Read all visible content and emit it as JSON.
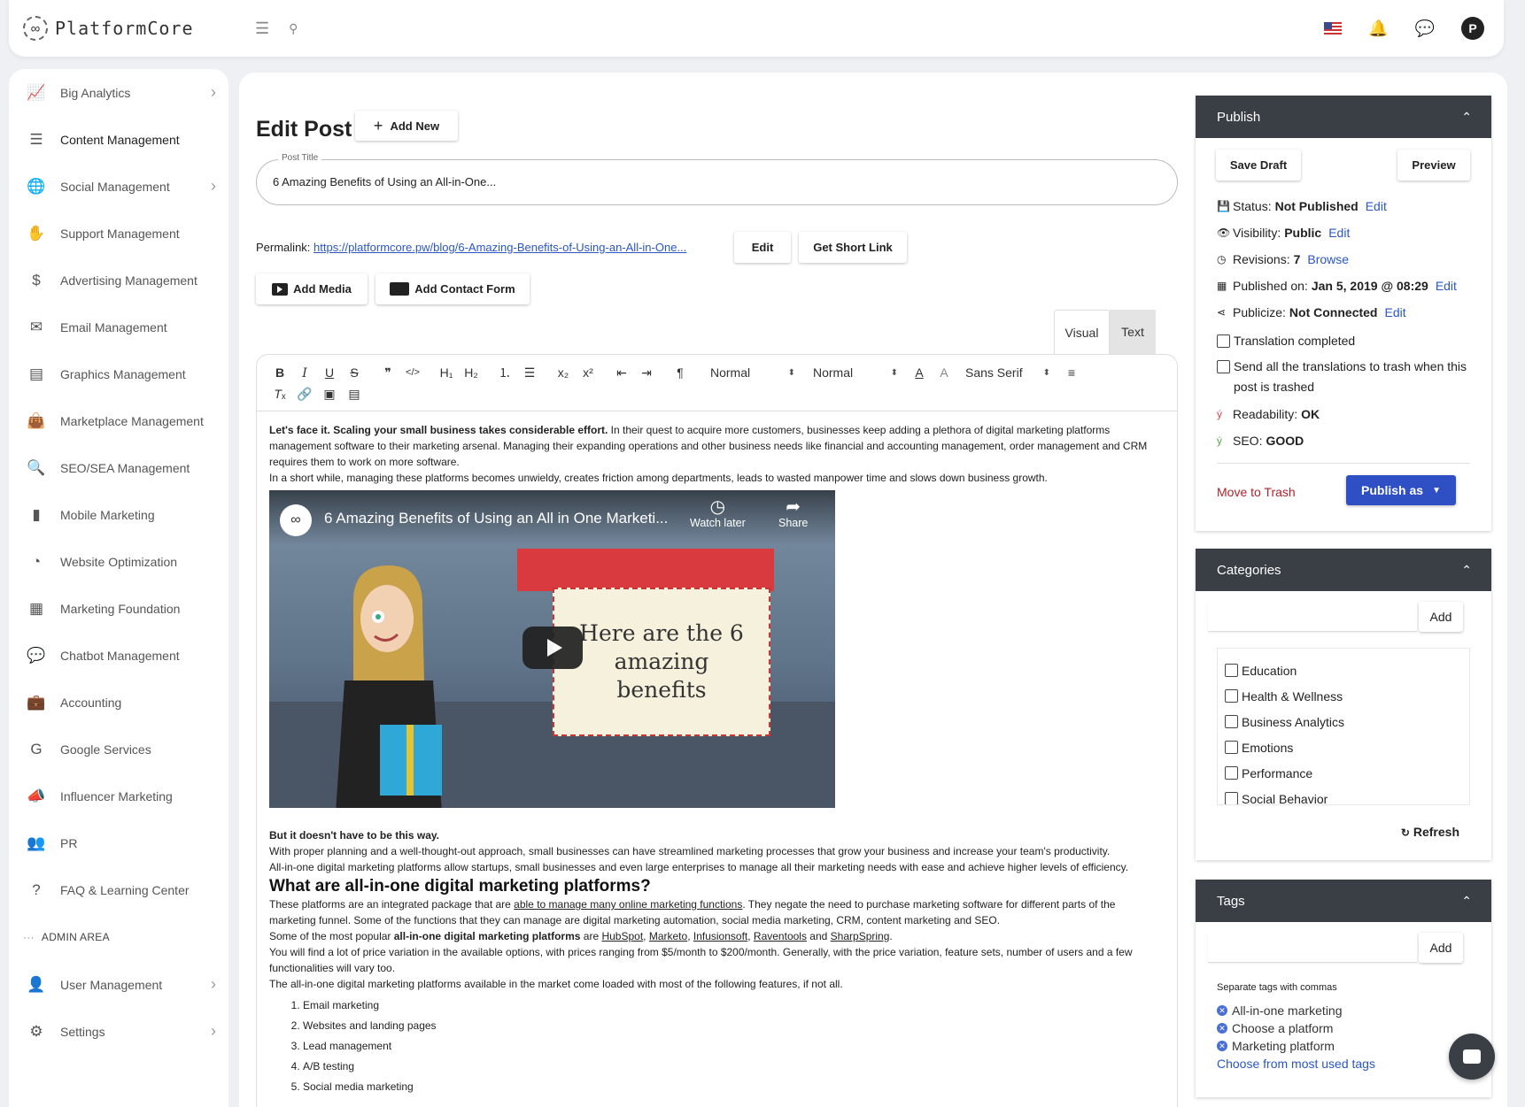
{
  "brand": {
    "name": "PlatformCore"
  },
  "topbar": {
    "menu_icon": "hamburger-icon",
    "search_icon": "search-icon",
    "flag_icon": "us-flag-icon",
    "bell_icon": "bell-icon",
    "chat_icon": "chat-icon",
    "avatar_letter": "P"
  },
  "sidebar": {
    "items": [
      {
        "label": "Big Analytics",
        "icon": "chart-line-icon",
        "glyph": "📈",
        "chevron": true
      },
      {
        "label": "Content Management",
        "icon": "list-icon",
        "glyph": "☰",
        "chevron": false
      },
      {
        "label": "Social Management",
        "icon": "globe-icon",
        "glyph": "🌐",
        "chevron": true
      },
      {
        "label": "Support Management",
        "icon": "hand-icon",
        "glyph": "✋",
        "chevron": false
      },
      {
        "label": "Advertising Management",
        "icon": "dollar-hand-icon",
        "glyph": "$",
        "chevron": false
      },
      {
        "label": "Email Management",
        "icon": "envelope-icon",
        "glyph": "✉",
        "chevron": false
      },
      {
        "label": "Graphics Management",
        "icon": "image-file-icon",
        "glyph": "▤",
        "chevron": false
      },
      {
        "label": "Marketplace Management",
        "icon": "bag-icon",
        "glyph": "👜",
        "chevron": false
      },
      {
        "label": "SEO/SEA Management",
        "icon": "search-dollar-icon",
        "glyph": "🔍",
        "chevron": false
      },
      {
        "label": "Mobile Marketing",
        "icon": "mobile-icon",
        "glyph": "▮",
        "chevron": false
      },
      {
        "label": "Website Optimization",
        "icon": "gauge-icon",
        "glyph": "◔",
        "chevron": false
      },
      {
        "label": "Marketing Foundation",
        "icon": "boxes-icon",
        "glyph": "▦",
        "chevron": false
      },
      {
        "label": "Chatbot Management",
        "icon": "chat-bubble-icon",
        "glyph": "💬",
        "chevron": false
      },
      {
        "label": "Accounting",
        "icon": "briefcase-icon",
        "glyph": "💼",
        "chevron": false
      },
      {
        "label": "Google Services",
        "icon": "google-icon",
        "glyph": "G",
        "chevron": false
      },
      {
        "label": "Influencer Marketing",
        "icon": "megaphone-icon",
        "glyph": "📣",
        "chevron": false
      },
      {
        "label": "PR",
        "icon": "users-icon",
        "glyph": "👥",
        "chevron": false
      },
      {
        "label": "FAQ & Learning Center",
        "icon": "question-icon",
        "glyph": "?",
        "chevron": false
      }
    ],
    "admin_section": "ADMIN AREA",
    "admin_items": [
      {
        "label": "User Management",
        "icon": "user-circle-icon",
        "glyph": "👤",
        "chevron": true
      },
      {
        "label": "Settings",
        "icon": "gear-icon",
        "glyph": "⚙",
        "chevron": true
      }
    ]
  },
  "editor": {
    "page_title": "Edit Post",
    "add_new_label": "Add New",
    "post_title_label": "Post Title",
    "post_title_value": "6 Amazing Benefits of Using an All-in-One...",
    "permalink_label": "Permalink:",
    "permalink_url": "https://platformcore.pw/blog/6-Amazing-Benefits-of-Using-an-All-in-One...",
    "edit_label": "Edit",
    "short_link_label": "Get Short Link",
    "add_media_label": "Add Media",
    "add_form_label": "Add Contact Form",
    "tab_visual": "Visual",
    "tab_text": "Text",
    "toolbar": {
      "heading_select": "Normal",
      "size_select": "Normal",
      "font_select": "Sans Serif"
    }
  },
  "content": {
    "p1_bold": "Let's face it. Scaling your small business takes considerable effort.",
    "p1_rest": " In their quest to acquire more customers, businesses keep adding a plethora of digital marketing platforms management software to their marketing arsenal. Managing their expanding operations and other business needs like financial and accounting management, order management and CRM requires them to work on more software.",
    "p2": "In a short while, managing these platforms becomes unwieldy, creates friction among departments, leads to wasted manpower time and slows down business growth.",
    "video_title": "6 Amazing Benefits of Using an All in One Marketi...",
    "video_watch_later": "Watch later",
    "video_share": "Share",
    "video_sign_l1": "Here are the 6",
    "video_sign_l2": "amazing",
    "video_sign_l3": "benefits",
    "p3_bold": "But it doesn't have to be this way.",
    "p4": "With proper planning and a well-thought-out approach, small businesses can have streamlined marketing processes that grow your business and increase your team's productivity.",
    "p5": "All-in-one digital marketing platforms allow startups, small businesses and even large enterprises to manage all their marketing needs with ease and achieve higher levels of efficiency.",
    "h2": "What are all-in-one digital marketing platforms?",
    "p6_a": "These platforms are an integrated package that are ",
    "p6_link": "able to manage many online marketing functions",
    "p6_b": ". They negate the need to purchase marketing software for different parts of the marketing funnel. Some of the functions that they can manage are digital marketing automation, social media marketing, CRM, content marketing and SEO.",
    "p7_a": "Some of the most popular ",
    "p7_bold": "all-in-one digital marketing platforms",
    "p7_b": " are ",
    "p7_l1": "HubSpot",
    "p7_c1": ", ",
    "p7_l2": "Marketo",
    "p7_c2": ", ",
    "p7_l3": "Infusionsoft",
    "p7_c3": ", ",
    "p7_l4": "Raventools",
    "p7_c4": " and ",
    "p7_l5": "SharpSpring",
    "p7_c5": ".",
    "p8": "You will find a lot of price variation in the available options, with prices ranging from $5/month to $200/month. Generally, with the price variation, feature sets, number of users and a few functionalities will vary too.",
    "p9": "The all-in-one digital marketing platforms available in the market come loaded with most of the following features, if not all.",
    "list": [
      "Email marketing",
      "Websites and landing pages",
      "Lead management",
      "A/B testing",
      "Social media marketing"
    ]
  },
  "publish": {
    "title": "Publish",
    "save_draft": "Save Draft",
    "preview": "Preview",
    "status_label": "Status:",
    "status_value": "Not Published",
    "visibility_label": "Visibility:",
    "visibility_value": "Public",
    "revisions_label": "Revisions:",
    "revisions_value": "7",
    "browse": "Browse",
    "published_label": "Published on:",
    "published_value": "Jan 5, 2019 @ 08:29",
    "publicize_label": "Publicize:",
    "publicize_value": "Not Connected",
    "edit": "Edit",
    "translation_completed": "Translation completed",
    "send_translations": "Send all the translations to trash when this post is trashed",
    "readability_label": "Readability:",
    "readability_value": "OK",
    "seo_label": "SEO:",
    "seo_value": "GOOD",
    "move_to_trash": "Move to Trash",
    "publish_as": "Publish as"
  },
  "categories": {
    "title": "Categories",
    "add": "Add",
    "items": [
      "Education",
      "Health & Wellness",
      "Business Analytics",
      "Emotions",
      "Performance",
      "Social Behavior"
    ],
    "refresh": "Refresh"
  },
  "tags": {
    "title": "Tags",
    "add": "Add",
    "note": "Separate tags with commas",
    "items": [
      "All-in-one marketing",
      "Choose a platform",
      "Marketing platform"
    ],
    "choose_most_used": "Choose from most used tags"
  }
}
